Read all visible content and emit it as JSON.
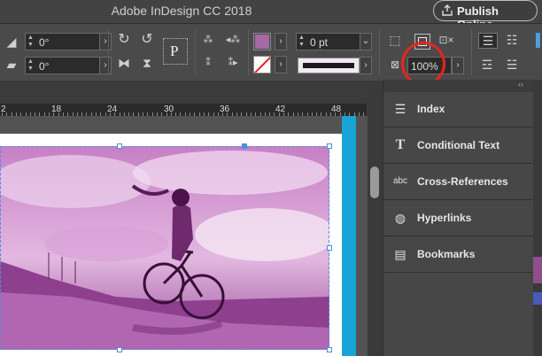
{
  "window": {
    "title": "Adobe InDesign CC 2018",
    "publish_label": "Publish Online"
  },
  "control_panel": {
    "rotate_angle": "0°",
    "shear_angle": "0°",
    "stroke_weight": "0 pt",
    "opacity": "100%",
    "type_on_path_glyph": "P",
    "fill_color": "#a668a6",
    "stroke_swatch": "#1b1b1b"
  },
  "ruler": {
    "labels": [
      "2",
      "18",
      "24",
      "30",
      "36",
      "42",
      "48"
    ]
  },
  "panels": {
    "items": [
      {
        "label": "Index",
        "icon": "index-icon"
      },
      {
        "label": "Conditional Text",
        "icon": "conditional-text-icon"
      },
      {
        "label": "Cross-References",
        "icon": "cross-references-icon"
      },
      {
        "label": "Hyperlinks",
        "icon": "hyperlinks-icon"
      },
      {
        "label": "Bookmarks",
        "icon": "bookmarks-icon"
      }
    ]
  },
  "colors": {
    "accent_bleed": "#19a4d8",
    "highlight_circle": "#e8241f",
    "photo_tint": "#b466b6"
  }
}
